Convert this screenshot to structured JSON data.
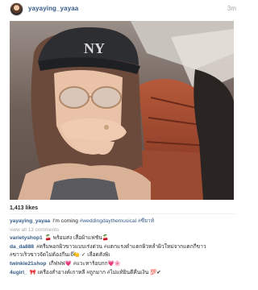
{
  "post": {
    "username": "yayaying_yayaa",
    "timestamp": "3m",
    "likes": "1,413 likes"
  },
  "caption": {
    "user": "yayaying_yayaa",
    "text": "I'm coming ",
    "hashtag1": "#weddingdaythemusical",
    "hashtag2": "#ซียาห์"
  },
  "view_all": "view all 13 comments",
  "comments": [
    {
      "user": "varietyshop1",
      "text": "🍒 พร้อมส่ง เสื้อผ้าแฟชั่น🍒"
    },
    {
      "user": "da_da888",
      "text": "#ครีมพอกผิวขาวแบบเร่งด่วน #แตกแรงด่ำแตกผิวหล้ำผิวใหม่จากแตกกี่ขาว"
    },
    {
      "user": "",
      "text": "#ขาวเร็วขาวจัดไม่ต้องกี่นเจ๊🍋 ✓ เลือดสั่งพิเ"
    },
    {
      "user": "twinkle21shop",
      "text": "เกี่ฟฟฟ💗 #แวะหาร้อบกก💗🌸"
    },
    {
      "user": "4ugirl_",
      "text": "🎀 เครื่องสำอางค์เกาหลี #ถูกมาก #ไม่แท้ยินดีคืนเงิน 💯✔"
    }
  ],
  "icons": {
    "avatar": "profile-avatar",
    "photo": "selfie-photo"
  }
}
